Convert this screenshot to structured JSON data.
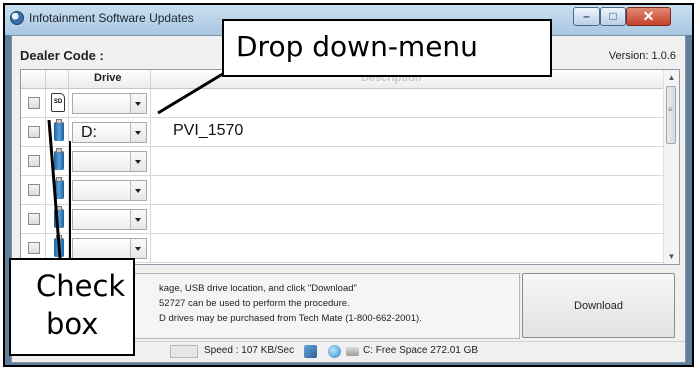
{
  "window": {
    "title": "Infotainment Software Updates",
    "controls": {
      "minimize": "–",
      "maximize": "□",
      "close": "✕"
    }
  },
  "header": {
    "dealer_code_label": "Dealer Code :",
    "version": "Version: 1.0.6"
  },
  "grid": {
    "columns": [
      "",
      "",
      "Drive",
      "Description"
    ],
    "rows": [
      {
        "icon": "sd-card-icon",
        "sd_label": "SD",
        "drive": "",
        "description": ""
      },
      {
        "icon": "usb-drive-icon",
        "drive": "D:",
        "description": "PVI_1570"
      },
      {
        "icon": "usb-drive-icon",
        "drive": "",
        "description": ""
      },
      {
        "icon": "usb-drive-icon",
        "drive": "",
        "description": ""
      },
      {
        "icon": "usb-drive-icon",
        "drive": "",
        "description": ""
      },
      {
        "icon": "usb-drive-icon",
        "drive": "",
        "description": ""
      }
    ]
  },
  "instructions": {
    "line1": "kage, USB drive location, and click \"Download\"",
    "line2": "52727 can be used to perform the procedure.",
    "line3": "D drives may be purchased from Tech Mate (1-800-662-2001)."
  },
  "download_button": {
    "label": "Download"
  },
  "status": {
    "speed": "Speed : 107 KB/Sec",
    "free_space": "C: Free Space 272.01 GB"
  },
  "annotations": {
    "dropdown_callout": "Drop down-menu",
    "checkbox_callout_line1": "Check",
    "checkbox_callout_line2": "box"
  },
  "colors": {
    "window_frame": "#5f7f9a",
    "titlebar": "#a9c7e2",
    "close_button": "#c3412a"
  }
}
